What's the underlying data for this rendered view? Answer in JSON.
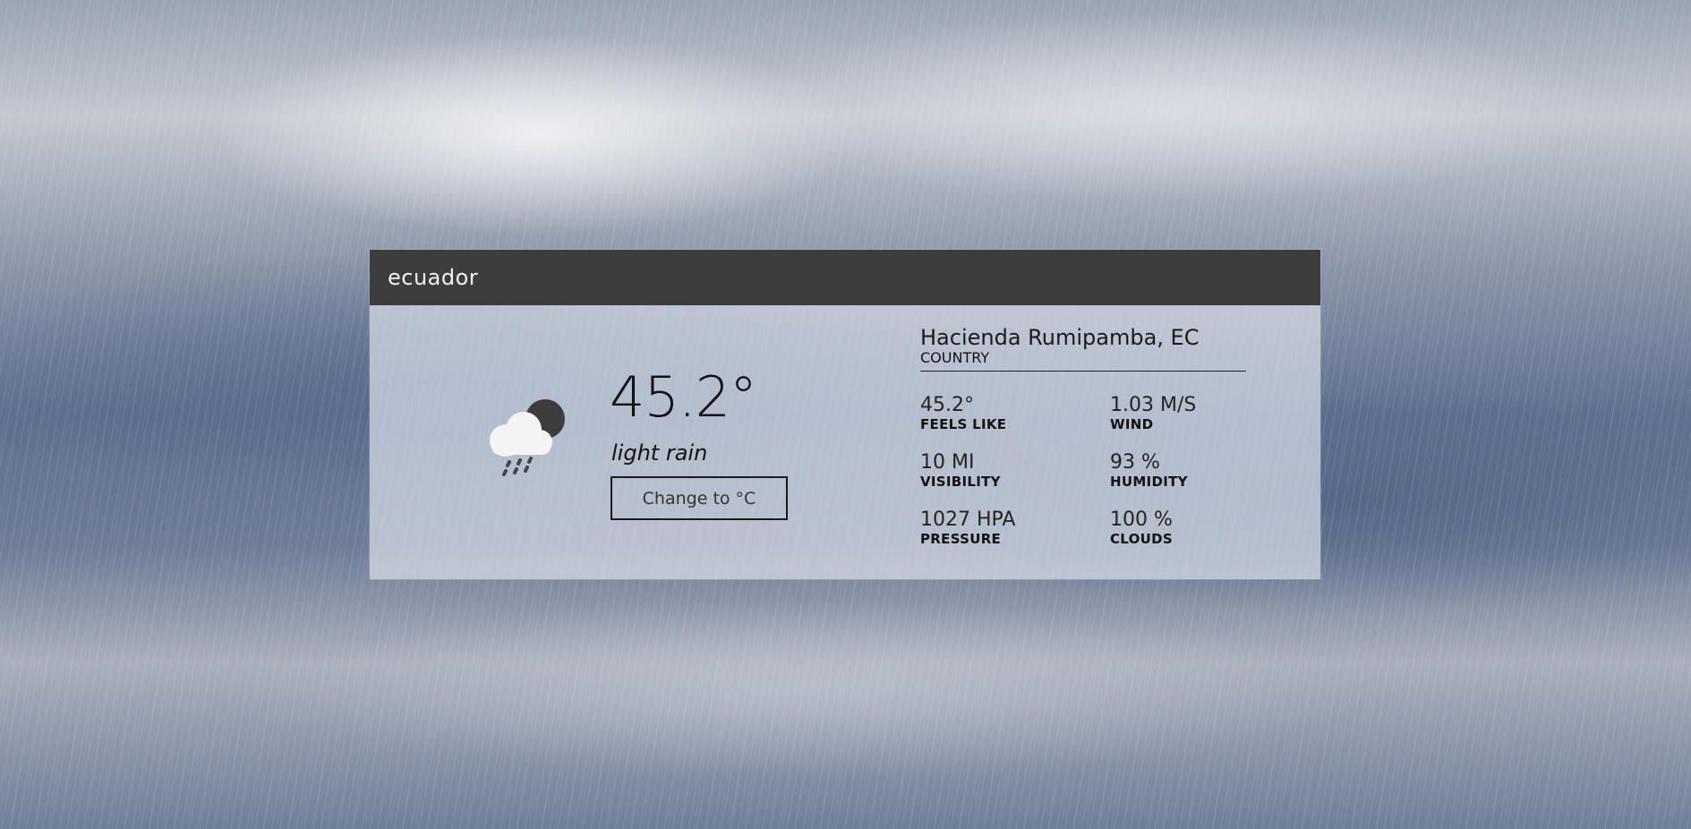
{
  "header": {
    "title": "ecuador"
  },
  "current": {
    "icon": "cloud-moon-rain-icon",
    "temperature": "45.2°",
    "description": "light rain",
    "unit_button_label": "Change to °C"
  },
  "location": {
    "name": "Hacienda Rumipamba, EC",
    "label": "COUNTRY"
  },
  "stats": [
    {
      "value": "45.2°",
      "label": "FEELS LIKE"
    },
    {
      "value": "1.03 M/S",
      "label": "WIND"
    },
    {
      "value": "10 MI",
      "label": "VISIBILITY"
    },
    {
      "value": "93 %",
      "label": "HUMIDITY"
    },
    {
      "value": "1027 HPA",
      "label": "PRESSURE"
    },
    {
      "value": "100 %",
      "label": "CLOUDS"
    }
  ],
  "colors": {
    "header_bg": "#3d3d3e",
    "text": "#111111"
  }
}
